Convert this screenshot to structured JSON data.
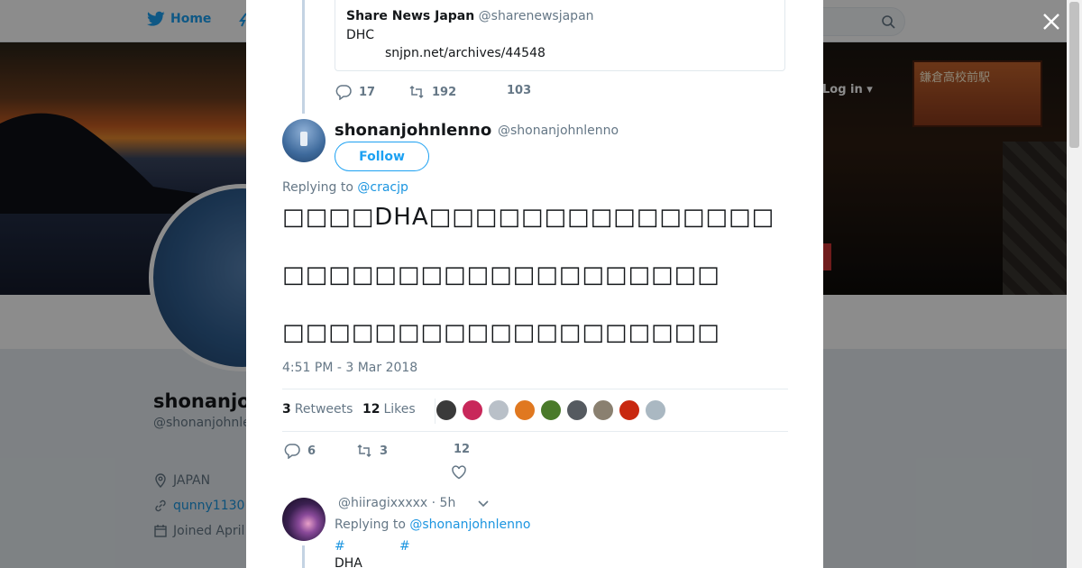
{
  "topbar": {
    "home_label": "Home",
    "login_label": "Log in"
  },
  "banner": {
    "sign_text": "鎌倉高校前駅"
  },
  "profile": {
    "name": "shonanjo",
    "handle": "@shonanjohnle",
    "location": "JAPAN",
    "website": "qunny1130",
    "joined": "Joined April"
  },
  "quoted_tweet": {
    "author_name": "Share News Japan",
    "author_handle": "@sharenewsjapan",
    "text": "DHC",
    "link": "snjpn.net/archives/44548",
    "replies": "17",
    "retweets": "192",
    "likes": "103"
  },
  "tweet": {
    "author_name": "shonanjohnlenno",
    "author_handle": "@shonanjohnlenno",
    "follow_label": "Follow",
    "replying_label": "Replying to",
    "replying_to": "@cracjp",
    "lines": [
      "□□□□DHA□□□□□□□□□□□□□□□",
      "□□□□□□□□□□□□□□□□□□□",
      "□□□□□□□□□□□□□□□□□□□"
    ],
    "timestamp": "4:51 PM - 3 Mar 2018",
    "retweet_count": "3",
    "retweet_label": "Retweets",
    "like_count": "12",
    "like_label": "Likes",
    "replies": "6",
    "retweets": "3",
    "likes": "12",
    "liker_colors": [
      "#3a3a3a",
      "#c8285a",
      "#b9c0c8",
      "#e07820",
      "#4a7a2a",
      "#555a60",
      "#8a8070",
      "#c82810",
      "#aab8c2"
    ]
  },
  "reply": {
    "author_handle": "@hiiragixxxxx",
    "time": "· 5h",
    "replying_label": "Replying to",
    "replying_to": "@shonanjohnlenno",
    "hashtag_1": "#",
    "hashtag_2": "#",
    "text": "DHA"
  },
  "icons": {
    "close": "close-icon",
    "reply": "reply-icon",
    "retweet": "retweet-icon",
    "like": "heart-icon"
  },
  "colors": {
    "accent": "#1da1f2",
    "link": "#1b95e0",
    "muted": "#657786",
    "overlay": "rgba(0,0,0,0.45)"
  }
}
